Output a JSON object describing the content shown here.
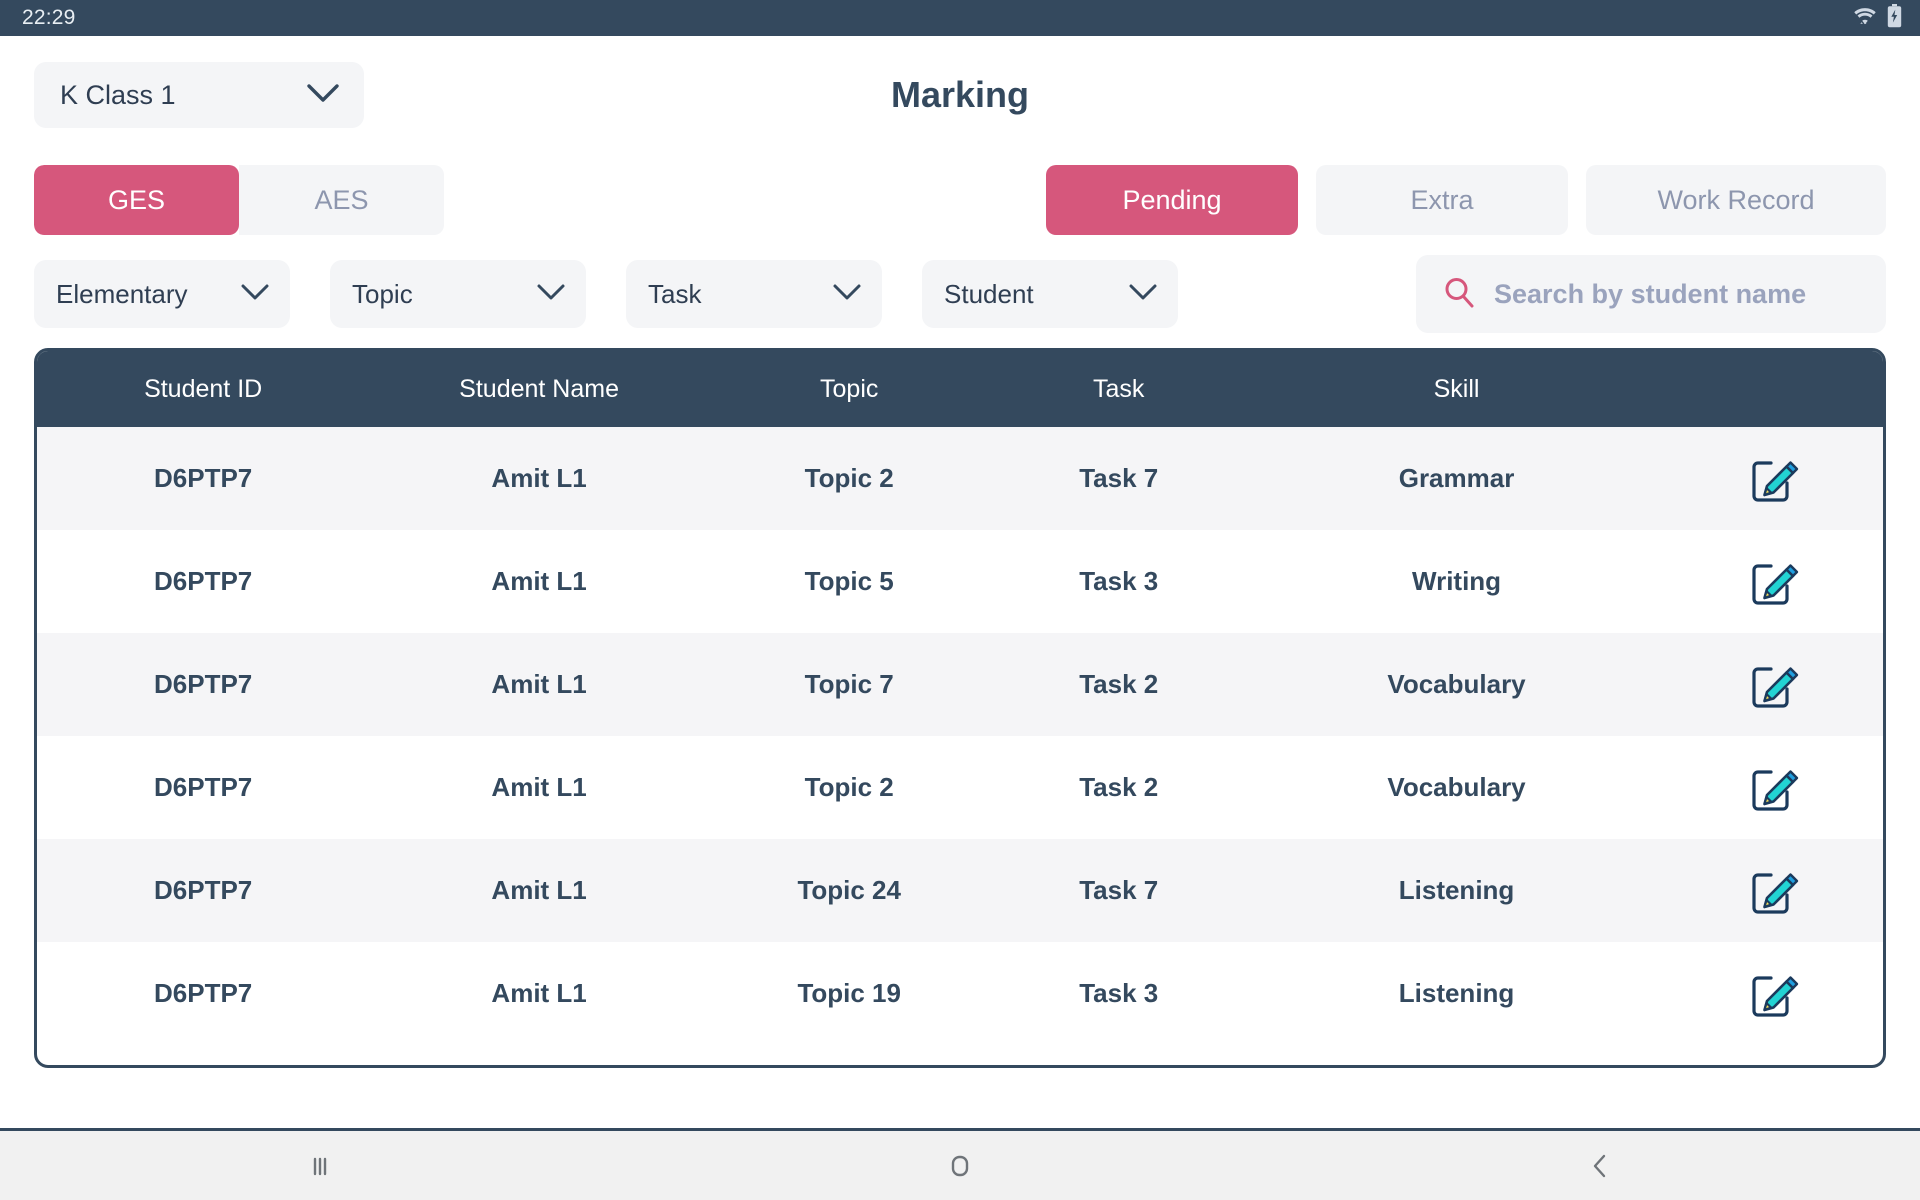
{
  "status_bar": {
    "time": "22:29",
    "icons": [
      "wifi-icon",
      "battery-charging-icon"
    ]
  },
  "header": {
    "title": "Marking",
    "class_selector": {
      "value": "K Class 1",
      "chevron": "chevron-down-icon"
    }
  },
  "segmented_control": {
    "options": [
      {
        "label": "GES",
        "active": true
      },
      {
        "label": "AES",
        "active": false
      }
    ]
  },
  "tabs": [
    {
      "label": "Pending",
      "active": true
    },
    {
      "label": "Extra",
      "active": false
    },
    {
      "label": "Work Record",
      "active": false
    }
  ],
  "filters": [
    {
      "label": "Elementary",
      "chevron": "chevron-down-icon"
    },
    {
      "label": "Topic",
      "chevron": "chevron-down-icon"
    },
    {
      "label": "Task",
      "chevron": "chevron-down-icon"
    },
    {
      "label": "Student",
      "chevron": "chevron-down-icon"
    }
  ],
  "search": {
    "icon": "search-icon",
    "placeholder": "Search by student name",
    "value": ""
  },
  "table": {
    "columns": [
      "Student ID",
      "Student Name",
      "Topic",
      "Task",
      "Skill",
      ""
    ],
    "action_icon": "edit-pencil-icon",
    "rows": [
      {
        "student_id": "D6PTP7",
        "student_name": "Amit L1",
        "topic": "Topic 2",
        "task": "Task 7",
        "skill": "Grammar"
      },
      {
        "student_id": "D6PTP7",
        "student_name": "Amit L1",
        "topic": "Topic 5",
        "task": "Task 3",
        "skill": "Writing"
      },
      {
        "student_id": "D6PTP7",
        "student_name": "Amit L1",
        "topic": "Topic 7",
        "task": "Task 2",
        "skill": "Vocabulary"
      },
      {
        "student_id": "D6PTP7",
        "student_name": "Amit L1",
        "topic": "Topic 2",
        "task": "Task 2",
        "skill": "Vocabulary"
      },
      {
        "student_id": "D6PTP7",
        "student_name": "Amit L1",
        "topic": "Topic 24",
        "task": "Task 7",
        "skill": "Listening"
      },
      {
        "student_id": "D6PTP7",
        "student_name": "Amit L1",
        "topic": "Topic 19",
        "task": "Task 3",
        "skill": "Listening"
      }
    ]
  },
  "nav_bar": {
    "buttons": [
      "recents-icon",
      "home-icon",
      "back-icon"
    ]
  },
  "colors": {
    "accent_pink": "#d6577c",
    "dark_navy": "#34495e",
    "muted_text": "#8d96ae",
    "field_bg": "#f4f5f7",
    "row_alt": "#f5f5f7",
    "pencil_cyan": "#22d3d3"
  }
}
